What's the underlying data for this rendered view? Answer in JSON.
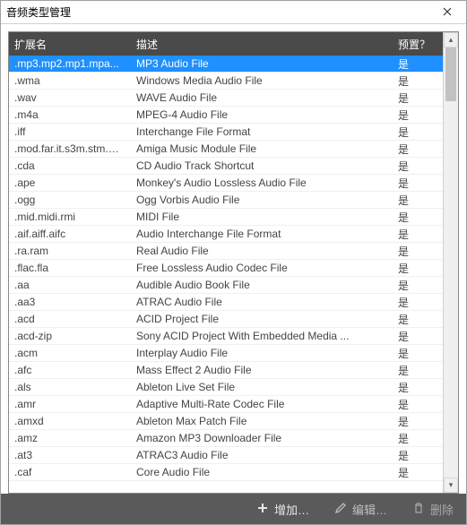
{
  "window": {
    "title": "音频类型管理"
  },
  "columns": {
    "ext": "扩展名",
    "desc": "描述",
    "preset": "预置？"
  },
  "rows": [
    {
      "ext": ".mp3.mp2.mp1.mpa...",
      "desc": "MP3 Audio File",
      "preset": "是",
      "selected": true
    },
    {
      "ext": ".wma",
      "desc": "Windows Media Audio File",
      "preset": "是"
    },
    {
      "ext": ".wav",
      "desc": "WAVE Audio File",
      "preset": "是"
    },
    {
      "ext": ".m4a",
      "desc": "MPEG-4 Audio File",
      "preset": "是"
    },
    {
      "ext": ".iff",
      "desc": "Interchange File Format",
      "preset": "是"
    },
    {
      "ext": ".mod.far.it.s3m.stm.m...",
      "desc": "Amiga Music Module File",
      "preset": "是"
    },
    {
      "ext": ".cda",
      "desc": "CD Audio Track Shortcut",
      "preset": "是"
    },
    {
      "ext": ".ape",
      "desc": "Monkey's Audio Lossless Audio File",
      "preset": "是"
    },
    {
      "ext": ".ogg",
      "desc": "Ogg Vorbis Audio File",
      "preset": "是"
    },
    {
      "ext": ".mid.midi.rmi",
      "desc": "MIDI File",
      "preset": "是"
    },
    {
      "ext": ".aif.aiff.aifc",
      "desc": "Audio Interchange File Format",
      "preset": "是"
    },
    {
      "ext": ".ra.ram",
      "desc": "Real Audio File",
      "preset": "是"
    },
    {
      "ext": ".flac.fla",
      "desc": "Free Lossless Audio Codec File",
      "preset": "是"
    },
    {
      "ext": ".aa",
      "desc": "Audible Audio Book File",
      "preset": "是"
    },
    {
      "ext": ".aa3",
      "desc": "ATRAC Audio File",
      "preset": "是"
    },
    {
      "ext": ".acd",
      "desc": "ACID Project File",
      "preset": "是"
    },
    {
      "ext": ".acd-zip",
      "desc": "Sony ACID Project With Embedded Media ...",
      "preset": "是"
    },
    {
      "ext": ".acm",
      "desc": "Interplay Audio File",
      "preset": "是"
    },
    {
      "ext": ".afc",
      "desc": "Mass Effect 2 Audio File",
      "preset": "是"
    },
    {
      "ext": ".als",
      "desc": "Ableton Live Set File",
      "preset": "是"
    },
    {
      "ext": ".amr",
      "desc": "Adaptive Multi-Rate Codec File",
      "preset": "是"
    },
    {
      "ext": ".amxd",
      "desc": "Ableton Max Patch File",
      "preset": "是"
    },
    {
      "ext": ".amz",
      "desc": "Amazon MP3 Downloader File",
      "preset": "是"
    },
    {
      "ext": ".at3",
      "desc": "ATRAC3 Audio File",
      "preset": "是"
    },
    {
      "ext": ".caf",
      "desc": "Core Audio File",
      "preset": "是"
    }
  ],
  "footer": {
    "add": "增加…",
    "edit": "编辑…",
    "delete": "删除"
  }
}
